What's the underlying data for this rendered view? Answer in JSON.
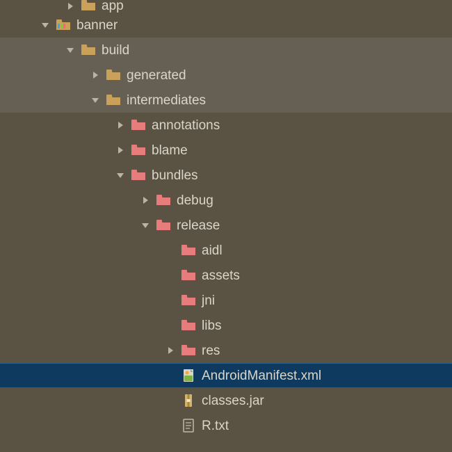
{
  "colors": {
    "folder_tan": "#c9a15a",
    "folder_pink": "#e77c7c",
    "arrow_fill": "#b9b4a4",
    "text": "#d9d6c9",
    "bg": "#5a5243",
    "highlight": "#666054",
    "selection": "#0f3a5f"
  },
  "rows": [
    {
      "indent": 2,
      "arrow": "right",
      "icon": "folder-tan",
      "label": "app",
      "cut": true
    },
    {
      "indent": 1,
      "arrow": "down",
      "icon": "module",
      "label": "banner"
    },
    {
      "indent": 2,
      "arrow": "down",
      "icon": "folder-tan",
      "label": "build",
      "highlight": true
    },
    {
      "indent": 3,
      "arrow": "right",
      "icon": "folder-tan",
      "label": "generated",
      "highlight": true
    },
    {
      "indent": 3,
      "arrow": "down",
      "icon": "folder-tan",
      "label": "intermediates",
      "highlight": true
    },
    {
      "indent": 4,
      "arrow": "right",
      "icon": "folder-pink",
      "label": "annotations"
    },
    {
      "indent": 4,
      "arrow": "right",
      "icon": "folder-pink",
      "label": "blame"
    },
    {
      "indent": 4,
      "arrow": "down",
      "icon": "folder-pink",
      "label": "bundles"
    },
    {
      "indent": 5,
      "arrow": "right",
      "icon": "folder-pink",
      "label": "debug"
    },
    {
      "indent": 5,
      "arrow": "down",
      "icon": "folder-pink",
      "label": "release"
    },
    {
      "indent": 6,
      "arrow": "none",
      "icon": "folder-pink",
      "label": "aidl"
    },
    {
      "indent": 6,
      "arrow": "none",
      "icon": "folder-pink",
      "label": "assets"
    },
    {
      "indent": 6,
      "arrow": "none",
      "icon": "folder-pink",
      "label": "jni"
    },
    {
      "indent": 6,
      "arrow": "none",
      "icon": "folder-pink",
      "label": "libs"
    },
    {
      "indent": 6,
      "arrow": "right",
      "icon": "folder-pink",
      "label": "res"
    },
    {
      "indent": 6,
      "arrow": "none",
      "icon": "xml",
      "label": "AndroidManifest.xml",
      "selected": true
    },
    {
      "indent": 6,
      "arrow": "none",
      "icon": "jar",
      "label": "classes.jar"
    },
    {
      "indent": 6,
      "arrow": "none",
      "icon": "txt",
      "label": "R.txt"
    }
  ]
}
